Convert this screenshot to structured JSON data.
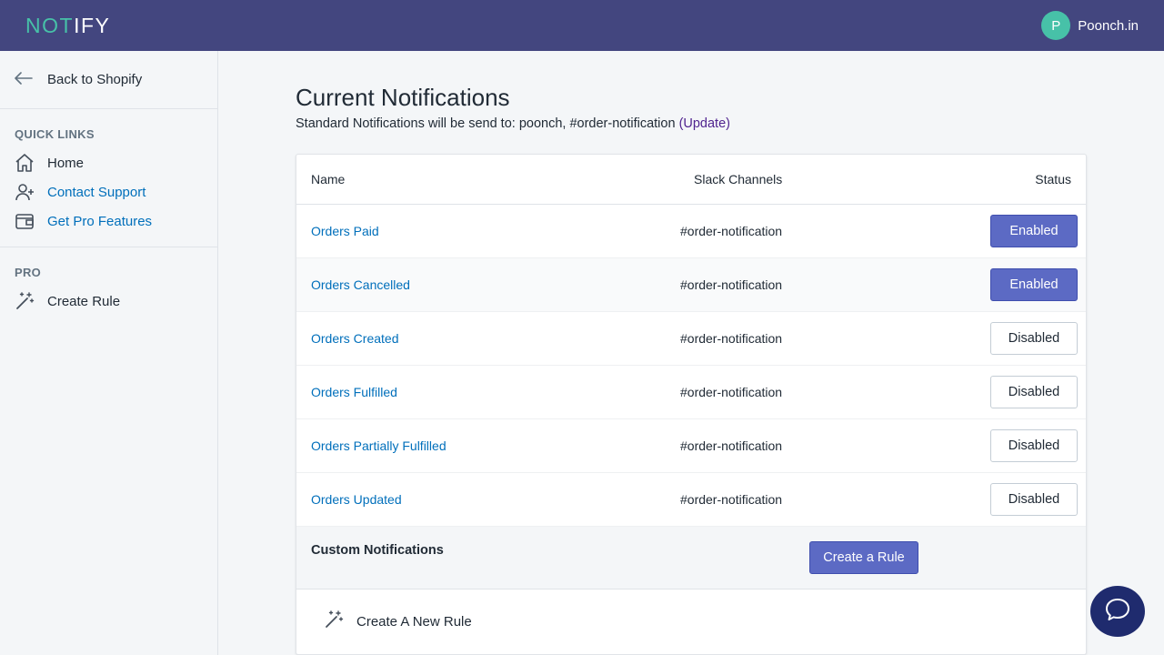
{
  "topbar": {
    "logo_a": "NOT",
    "logo_b": "IFY",
    "avatar_initial": "P",
    "account_name": "Poonch.in"
  },
  "sidebar": {
    "back_label": "Back to Shopify",
    "quick_links_title": "QUICK LINKS",
    "quick_links": [
      {
        "label": "Home",
        "icon": "home-icon"
      },
      {
        "label": "Contact Support",
        "icon": "add-user-icon"
      },
      {
        "label": "Get Pro Features",
        "icon": "wallet-icon"
      }
    ],
    "pro_title": "PRO",
    "pro_items": [
      {
        "label": "Create Rule",
        "icon": "magic-wand-icon"
      }
    ]
  },
  "main": {
    "title": "Current Notifications",
    "subtitle_prefix": "Standard Notifications will be send to: poonch, #order-notification",
    "subtitle_link": "(Update)",
    "table": {
      "headers": {
        "name": "Name",
        "channels": "Slack Channels",
        "status": "Status"
      },
      "rows": [
        {
          "name": "Orders Paid",
          "channel": "#order-notification",
          "status": "Enabled"
        },
        {
          "name": "Orders Cancelled",
          "channel": "#order-notification",
          "status": "Enabled"
        },
        {
          "name": "Orders Created",
          "channel": "#order-notification",
          "status": "Disabled"
        },
        {
          "name": "Orders Fulfilled",
          "channel": "#order-notification",
          "status": "Disabled"
        },
        {
          "name": "Orders Partially Fulfilled",
          "channel": "#order-notification",
          "status": "Disabled"
        },
        {
          "name": "Orders Updated",
          "channel": "#order-notification",
          "status": "Disabled"
        }
      ]
    },
    "custom": {
      "title": "Custom Notifications",
      "create_button": "Create a Rule",
      "new_rule_label": "Create A New Rule"
    }
  },
  "colors": {
    "topbar": "#43467f",
    "accent": "#5c6ac4",
    "logo_green": "#47c1a8",
    "link_blue": "#006fbb",
    "chat_bubble": "#1f2b6e"
  }
}
